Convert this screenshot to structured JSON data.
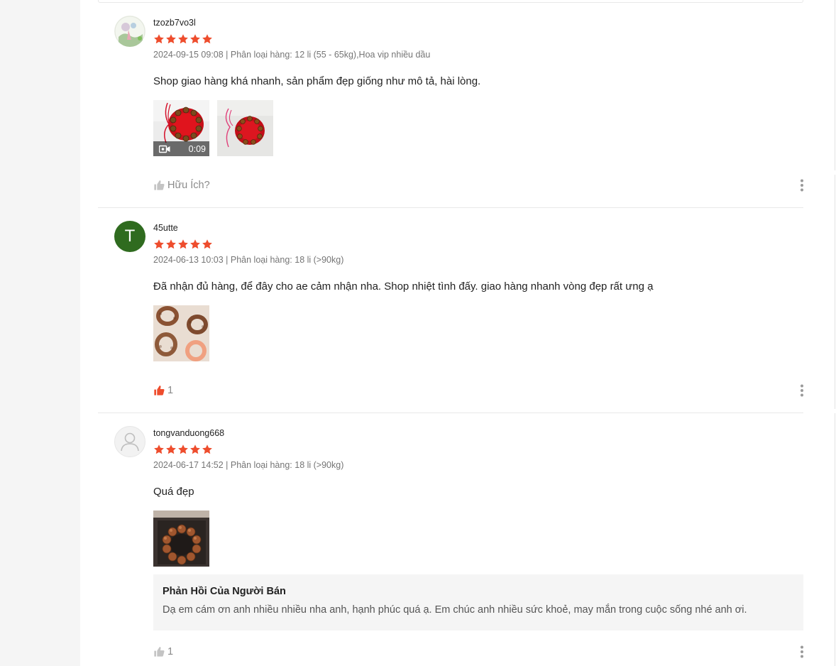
{
  "colors": {
    "star": "#ee4d2d",
    "liked": "#ee4d2d",
    "muted": "#8a8a8a",
    "avatar_green": "#2f6b1f"
  },
  "reviews": [
    {
      "username": "tzozb7vo3l",
      "rating": 5,
      "meta": "2024-09-15 09:08 | Phân loại hàng: 12 li (55 - 65kg),Hoa vip nhiều dầu",
      "content": "Shop giao hàng khá nhanh, sản phẩm đẹp giống như mô tả, hài lòng.",
      "media": [
        {
          "kind": "video",
          "duration": "0:09",
          "icon": "video-camera-icon"
        },
        {
          "kind": "image"
        }
      ],
      "helpful_label": "Hữu Ích?",
      "liked": false
    },
    {
      "username": "45utte",
      "avatar_letter": "T",
      "rating": 5,
      "meta": "2024-06-13 10:03 | Phân loại hàng: 18 li (>90kg)",
      "content": "Đã nhận đủ hàng, để đây cho ae cảm nhận nha. Shop nhiệt tình đấy.  giao hàng nhanh vòng đẹp rất ưng ạ",
      "media": [
        {
          "kind": "image"
        }
      ],
      "helpful_label": "1",
      "liked": true
    },
    {
      "username": "tongvanduong668",
      "rating": 5,
      "meta": "2024-06-17 14:52 | Phân loại hàng: 18 li (>90kg)",
      "content": "Quá đẹp",
      "media": [
        {
          "kind": "image"
        }
      ],
      "seller_reply": {
        "title": "Phản Hồi Của Người Bán",
        "text": "Dạ em cám ơn anh nhiều nhiều nha anh, hạnh phúc quá ạ. Em chúc anh nhiều sức khoẻ, may mắn trong cuộc sống nhé anh ơi."
      },
      "helpful_label": "1",
      "liked": false
    }
  ]
}
